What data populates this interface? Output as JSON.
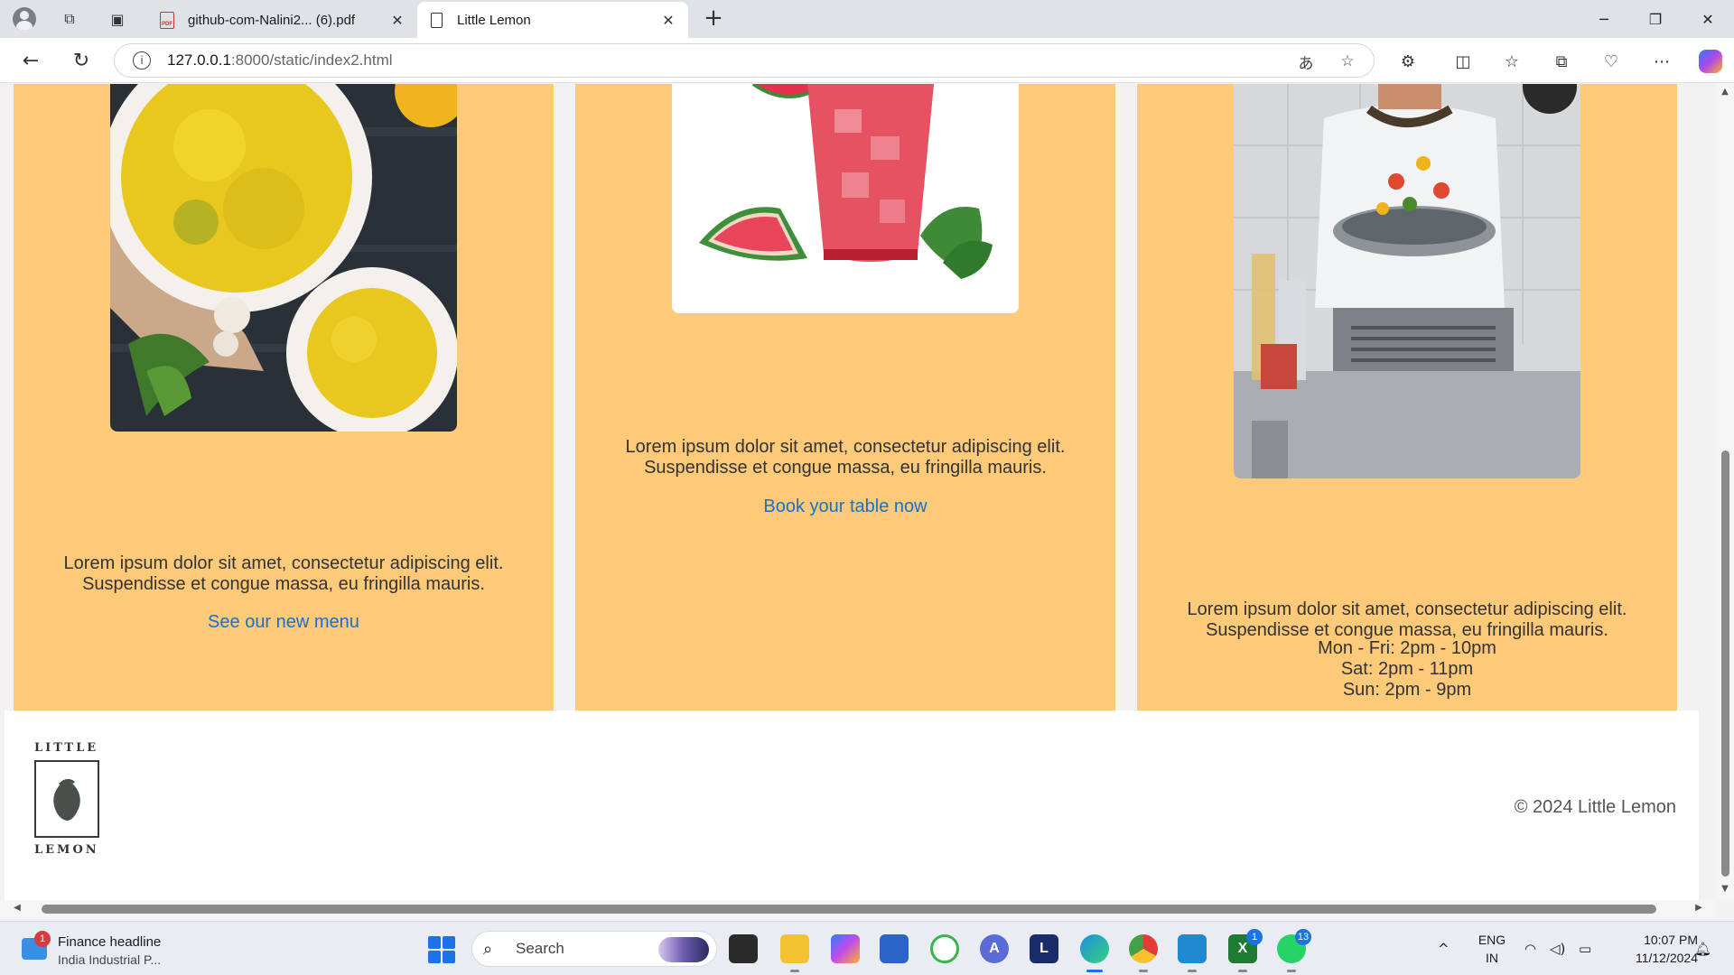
{
  "browser": {
    "tabs": [
      {
        "title": "github-com-Nalini2... (6).pdf",
        "icon": "pdf-icon",
        "active": false
      },
      {
        "title": "Little Lemon",
        "icon": "document-icon",
        "active": true
      }
    ],
    "url_host": "127.0.0.1",
    "url_path": ":8000/static/index2.html"
  },
  "cards": [
    {
      "description": "Lorem ipsum dolor sit amet, consectetur adipiscing elit. Suspendisse et congue massa, eu fringilla mauris.",
      "link": "See our new menu",
      "image": "yellow-rice-dish"
    },
    {
      "description": "Lorem ipsum dolor sit amet, consectetur adipiscing elit. Suspendisse et congue massa, eu fringilla mauris.",
      "link": "Book your table now",
      "image": "watermelon-drink"
    },
    {
      "description": "Lorem ipsum dolor sit amet, consectetur adipiscing elit. Suspendisse et congue massa, eu fringilla mauris.",
      "hours": [
        "Mon - Fri: 2pm - 10pm",
        "Sat: 2pm - 11pm",
        "Sun: 2pm - 9pm"
      ],
      "image": "chef-tossing-wok"
    }
  ],
  "footer": {
    "logo_top": "LITTLE",
    "logo_bottom": "LEMON",
    "copyright": "© 2024 Little Lemon"
  },
  "taskbar": {
    "news_title": "Finance headline",
    "news_sub": "India Industrial P...",
    "news_badge": "1",
    "search_label": "Search",
    "lang_top": "ENG",
    "lang_bottom": "IN",
    "time": "10:07 PM",
    "date": "11/12/2024",
    "badges": {
      "xbox": "1",
      "whatsapp": "13"
    }
  },
  "colors": {
    "card_bg": "#fdca7a",
    "link": "#1a6fc9",
    "page_bg": "#f2f2f2"
  }
}
